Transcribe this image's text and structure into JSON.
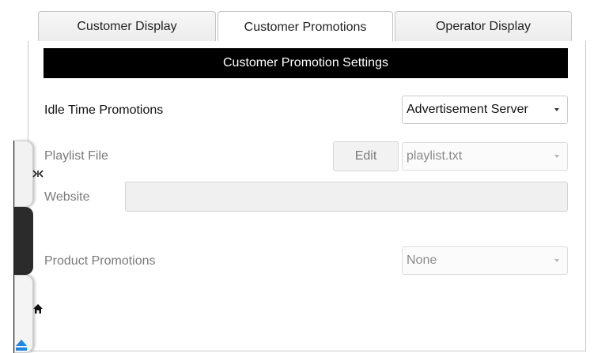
{
  "tabs": [
    {
      "label": "Customer Display"
    },
    {
      "label": "Customer Promotions"
    },
    {
      "label": "Operator Display"
    }
  ],
  "section": {
    "title": "Customer Promotion Settings"
  },
  "idle_time": {
    "label": "Idle Time Promotions",
    "value": "Advertisement Server"
  },
  "playlist": {
    "label": "Playlist File",
    "edit_label": "Edit",
    "value": "playlist.txt"
  },
  "website": {
    "label": "Website",
    "value": ""
  },
  "product_promotions": {
    "label": "Product Promotions",
    "value": "None"
  },
  "side_icons": [
    "collapse-arrows-icon",
    "play-icon",
    "home-icon",
    "eject-icon"
  ],
  "colors": {
    "header_bg": "#000000",
    "header_text": "#ffffff",
    "drawer_dark": "#2b2b2b",
    "eject_blue": "#1e88e5"
  }
}
